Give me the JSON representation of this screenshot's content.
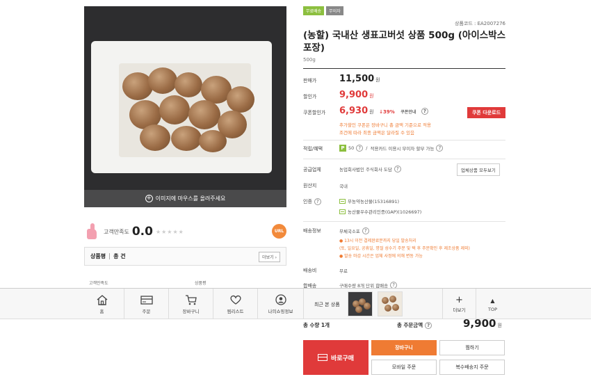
{
  "product": {
    "badges": [
      "무료배송",
      "무이자"
    ],
    "code": "상품코드 : EA2007276",
    "title": "(농할) 국내산 생표고버섯 상품 500g (아이스박스 포장)",
    "weight": "500g",
    "image_hover_text": "이미지에 마우스를 올려주세요"
  },
  "satisfaction": {
    "label": "고객만족도",
    "score": "0.0",
    "stars": "★★★★★",
    "url_badge": "URL"
  },
  "reviews": {
    "title": "상품평",
    "count": "총 건",
    "more": "더보기",
    "columns": [
      "고객만족도",
      "상품평"
    ]
  },
  "pricing": {
    "list_label": "판매가",
    "list_price": "11,500",
    "sale_label": "할인가",
    "sale_price": "9,900",
    "coupon_label": "쿠폰할인가",
    "coupon_price": "6,930",
    "won": "원",
    "discount": "39%",
    "coupon_info": "쿠폰안내",
    "coupon_button": "쿠폰 다운로드",
    "coupon_note_1": "추가할인 쿠폰은 장바구니 총 금액 기준으로 적용",
    "coupon_note_2": "조건에 따라 최종 금액은 달라질 수 있음"
  },
  "details": {
    "points_label": "적립/혜택",
    "points_value": "50",
    "points_extra": "적용카드 이용시 무이자 할부 가능",
    "seller_label": "공급업체",
    "seller_value": "농업회사법인 주식회사 도담",
    "seller_button": "업체상품 모두보기",
    "origin_label": "원산지",
    "origin_value": "국내",
    "cert_label": "인증",
    "cert_1": "무농약농산물(15316891)",
    "cert_2": "농산물우수관리인증(GAP)(1026697)",
    "shipping_label": "배송정보",
    "shipping_value": "무체국소포",
    "shipping_note_1": "● 13시 이전 결제완료분까지 당일 발송처리",
    "shipping_note_2": "(토, 일요일, 공휴일, 명절 성수기 주문 및 택 후 주문확인 후 제조상품 제외)",
    "shipping_note_3": "● 발송 마감 시간은 업체 사정에 의해 변동 가능",
    "fee_label": "배송비",
    "fee_value": "무료",
    "bundle_label": "합배송",
    "bundle_value": "구매수량 8개 단위 합배송"
  },
  "bottom_nav": {
    "home": "홈",
    "order": "주문",
    "cart": "장바구니",
    "wishlist": "찜리스트",
    "myinfo": "나의쇼핑정보",
    "recent": "최근 본 상품",
    "more": "더보기",
    "top": "TOP"
  },
  "purchase": {
    "qty_label": "총 수량 1개",
    "total_label": "총 주문금액",
    "total_price": "9,900",
    "won": "원",
    "buy_now": "바로구매",
    "cart": "장바구니",
    "wish": "찜하기",
    "mobile_order": "모바일 주문",
    "multi_ship": "복수배송지 주문"
  },
  "colors": {
    "accent_red": "#e03a3a",
    "accent_orange": "#ef7b33",
    "badge_green": "#8cbf3f"
  }
}
